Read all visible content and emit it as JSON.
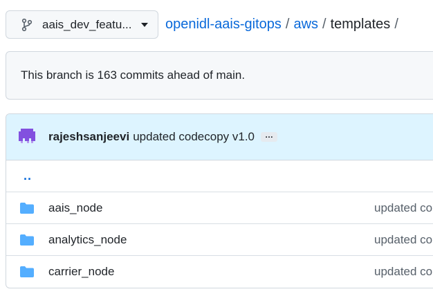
{
  "branch": {
    "name": "aais_dev_featu...",
    "icon": "git-branch-icon"
  },
  "breadcrumb": {
    "repo": "openidl-aais-gitops",
    "sep1": "/",
    "folder": "aws",
    "sep2": "/",
    "current": "templates",
    "sep3": "/"
  },
  "ahead_notice": "This branch is 163 commits ahead of main.",
  "latest_commit": {
    "author": "rajeshsanjeevi",
    "message": "updated codecopy v1.0",
    "more_label": "…"
  },
  "parent_dir_label": "..",
  "files": [
    {
      "name": "aais_node",
      "type": "folder",
      "commit": "updated co"
    },
    {
      "name": "analytics_node",
      "type": "folder",
      "commit": "updated co"
    },
    {
      "name": "carrier_node",
      "type": "folder",
      "commit": "updated co"
    }
  ],
  "colors": {
    "link": "#0969da",
    "folder": "#54aeff",
    "commit_bg": "#ddf4ff",
    "avatar": "#8250df"
  }
}
